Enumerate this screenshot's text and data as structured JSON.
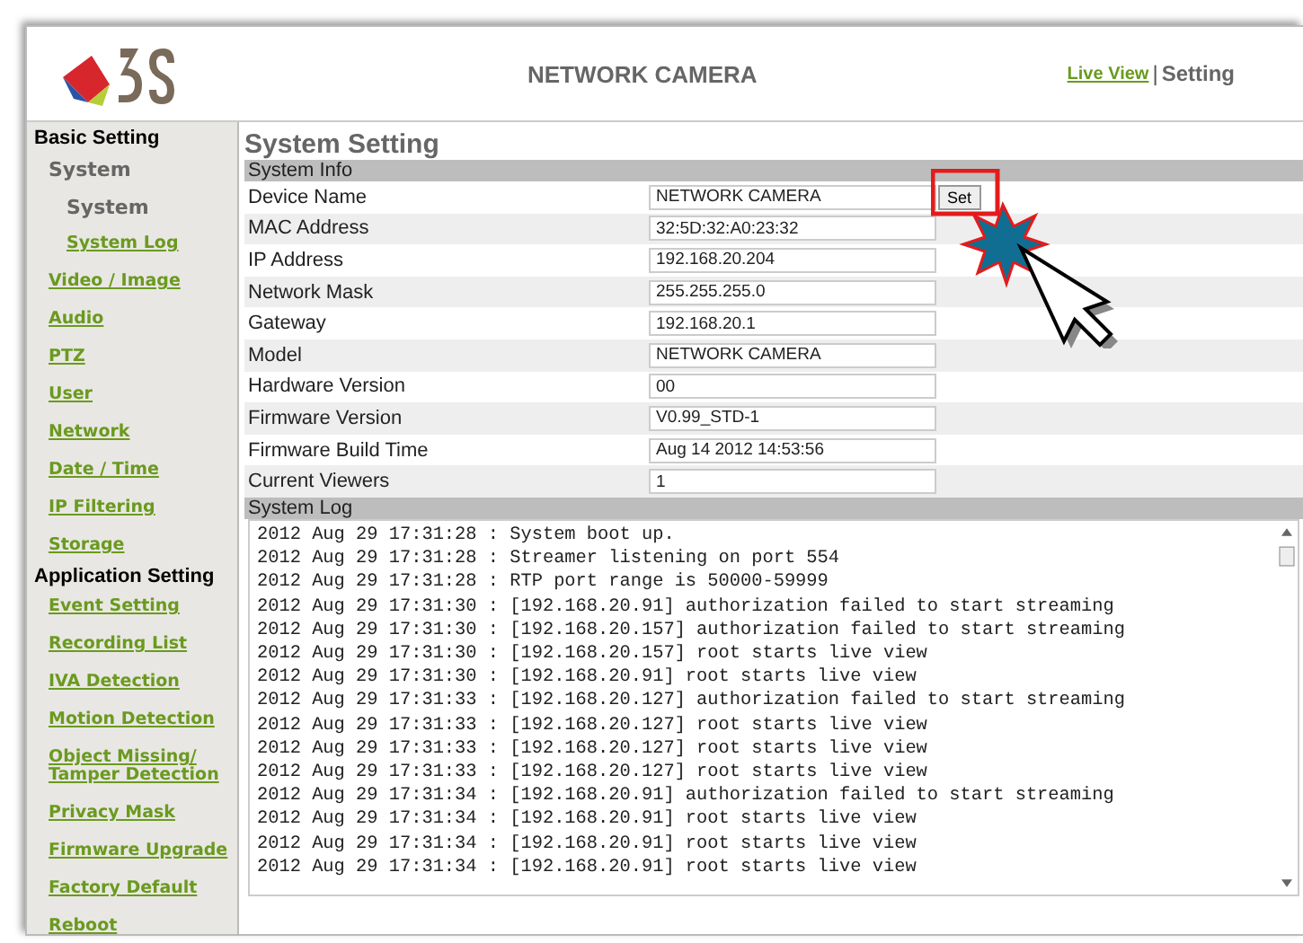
{
  "header": {
    "title": "NETWORK CAMERA",
    "separator": "|",
    "links": [
      {
        "label": "Live View",
        "selected": false
      },
      {
        "label": "Setting",
        "selected": true
      }
    ]
  },
  "sidebar": {
    "sections": [
      {
        "title": "Basic Setting",
        "items": [
          {
            "label": "System",
            "selected": true,
            "children": [
              {
                "label": "System",
                "selected": true
              },
              {
                "label": "System Log",
                "selected": false
              }
            ]
          },
          {
            "label": "Video / Image",
            "selected": false
          },
          {
            "label": "Audio",
            "selected": false
          },
          {
            "label": "PTZ",
            "selected": false
          },
          {
            "label": "User",
            "selected": false
          },
          {
            "label": "Network",
            "selected": false
          },
          {
            "label": "Date / Time",
            "selected": false
          },
          {
            "label": "IP Filtering",
            "selected": false
          },
          {
            "label": "Storage",
            "selected": false
          }
        ]
      },
      {
        "title": "Application Setting",
        "items": [
          {
            "label": "Event Setting",
            "selected": false
          },
          {
            "label": "Recording List",
            "selected": false
          },
          {
            "label": "IVA Detection",
            "selected": false
          },
          {
            "label": "Motion Detection",
            "selected": false
          },
          {
            "label": "Object Missing/\nTamper Detection",
            "selected": false
          },
          {
            "label": "Privacy Mask",
            "selected": false
          },
          {
            "label": "Firmware Upgrade",
            "selected": false
          },
          {
            "label": "Factory Default",
            "selected": false
          },
          {
            "label": "Reboot",
            "selected": false
          }
        ]
      }
    ]
  },
  "page_title": "System Setting",
  "system_info": {
    "title": "System Info",
    "rows": [
      {
        "label": "Device Name",
        "value": "NETWORK CAMERA",
        "button": "Set"
      },
      {
        "label": "MAC Address",
        "value": "32:5D:32:A0:23:32"
      },
      {
        "label": "IP Address",
        "value": "192.168.20.204"
      },
      {
        "label": "Network Mask",
        "value": "255.255.255.0"
      },
      {
        "label": "Gateway",
        "value": "192.168.20.1"
      },
      {
        "label": "Model",
        "value": "NETWORK CAMERA"
      },
      {
        "label": "Hardware Version",
        "value": "00"
      },
      {
        "label": "Firmware Version",
        "value": "V0.99_STD-1"
      },
      {
        "label": "Firmware Build Time",
        "value": "Aug 14 2012 14:53:56"
      },
      {
        "label": "Current Viewers",
        "value": "1"
      }
    ]
  },
  "system_log": {
    "title": "System Log",
    "lines": [
      "2012 Aug 29 17:31:28 : System boot up.",
      "2012 Aug 29 17:31:28 : Streamer listening on port 554",
      "2012 Aug 29 17:31:28 : RTP port range is 50000-59999",
      "2012 Aug 29 17:31:30 : [192.168.20.91] authorization failed to start streaming",
      "2012 Aug 29 17:31:30 : [192.168.20.157] authorization failed to start streaming",
      "2012 Aug 29 17:31:30 : [192.168.20.157] root starts live view",
      "2012 Aug 29 17:31:30 : [192.168.20.91] root starts live view",
      "2012 Aug 29 17:31:33 : [192.168.20.127] authorization failed to start streaming",
      "2012 Aug 29 17:31:33 : [192.168.20.127] root starts live view",
      "2012 Aug 29 17:31:33 : [192.168.20.127] root starts live view",
      "2012 Aug 29 17:31:33 : [192.168.20.127] root starts live view",
      "2012 Aug 29 17:31:34 : [192.168.20.91] authorization failed to start streaming",
      "2012 Aug 29 17:31:34 : [192.168.20.91] root starts live view",
      "2012 Aug 29 17:31:34 : [192.168.20.91] root starts live view",
      "2012 Aug 29 17:31:34 : [192.168.20.91] root starts live view"
    ]
  }
}
